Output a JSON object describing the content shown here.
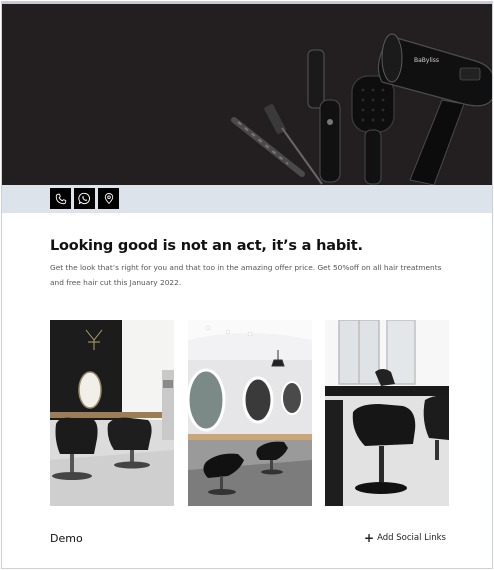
{
  "contact": {
    "buttons": [
      {
        "icon": "phone-icon"
      },
      {
        "icon": "whatsapp-icon"
      },
      {
        "icon": "location-pin-icon"
      }
    ]
  },
  "hero": {
    "background": "#231f20",
    "tool_brand": "BaByliss"
  },
  "main": {
    "headline": "Looking good is not an act, it’s a habit.",
    "description": "Get the look that’s right for you and that too in the amazing offer price. Get 50%off on all hair treatments and free hair cut this January 2022."
  },
  "gallery": {
    "images": [
      {
        "subject": "salon-chairs-mirror"
      },
      {
        "subject": "salon-round-mirrors"
      },
      {
        "subject": "salon-wash-station"
      }
    ]
  },
  "footer": {
    "name": "Demo",
    "add_social_label": "Add Social Links"
  },
  "colors": {
    "contact_bar": "#dde3ea",
    "button_bg": "#000000",
    "text": "#111111"
  }
}
